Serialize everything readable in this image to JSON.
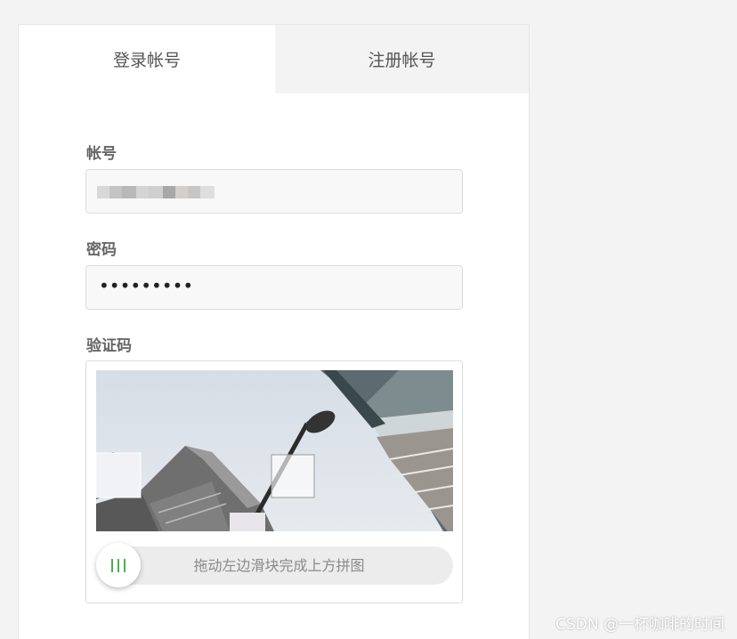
{
  "tabs": {
    "login": "登录帐号",
    "register": "注册帐号"
  },
  "form": {
    "account_label": "帐号",
    "password_label": "密码",
    "password_value": "•••••••••",
    "captcha_label": "验证码"
  },
  "captcha": {
    "slider_hint": "拖动左边滑块完成上方拼图",
    "slider_progress": 0
  },
  "watermark": "CSDN @一杯咖啡的时间",
  "colors": {
    "accent": "#4caf50",
    "page_bg": "#f3f3f3",
    "tab_inactive_bg": "#f3f3f3"
  },
  "icons": {
    "slider_handle": "grip-lines-icon"
  }
}
